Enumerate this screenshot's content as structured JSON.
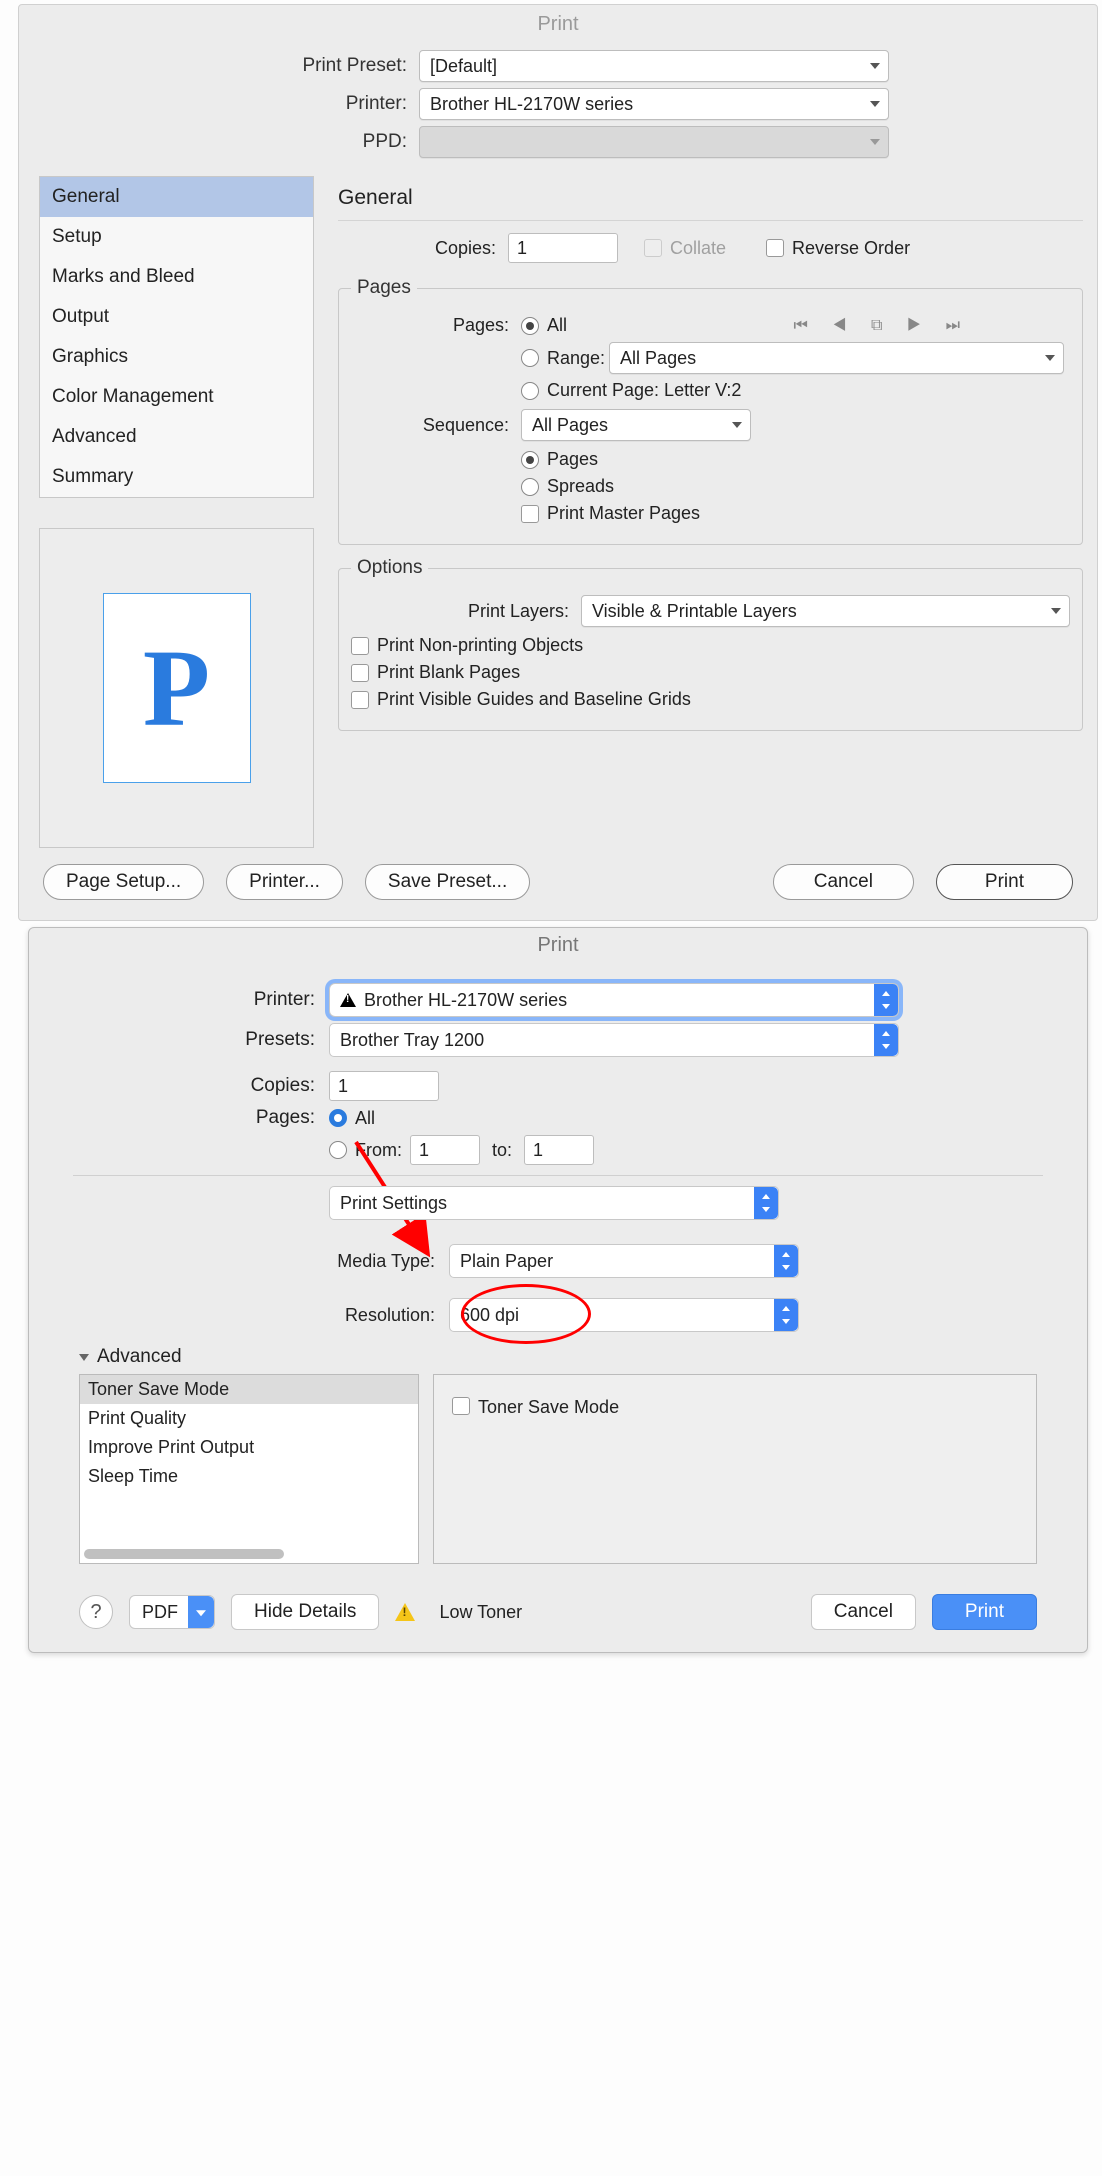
{
  "dialog1": {
    "title": "Print",
    "preset_label": "Print Preset:",
    "preset_value": "[Default]",
    "printer_label": "Printer:",
    "printer_value": "Brother HL-2170W series",
    "ppd_label": "PPD:",
    "sidebar": {
      "items": [
        "General",
        "Setup",
        "Marks and Bleed",
        "Output",
        "Graphics",
        "Color Management",
        "Advanced",
        "Summary"
      ],
      "selected": 0
    },
    "preview_letter": "P",
    "section_title": "General",
    "copies_label": "Copies:",
    "copies_value": "1",
    "collate_label": "Collate",
    "reverse_label": "Reverse Order",
    "pages_group": "Pages",
    "pages_label": "Pages:",
    "pages_all": "All",
    "pages_range": "Range:",
    "range_value": "All Pages",
    "current_page": "Current Page: Letter V:2",
    "sequence_label": "Sequence:",
    "sequence_value": "All Pages",
    "seq_pages": "Pages",
    "seq_spreads": "Spreads",
    "print_master": "Print Master Pages",
    "options_group": "Options",
    "print_layers_label": "Print Layers:",
    "print_layers_value": "Visible & Printable Layers",
    "opt1": "Print Non-printing Objects",
    "opt2": "Print Blank Pages",
    "opt3": "Print Visible Guides and Baseline Grids",
    "btn_page_setup": "Page Setup...",
    "btn_printer": "Printer...",
    "btn_save_preset": "Save Preset...",
    "btn_cancel": "Cancel",
    "btn_print": "Print"
  },
  "dialog2": {
    "title": "Print",
    "printer_label": "Printer:",
    "printer_value": "Brother HL-2170W series",
    "presets_label": "Presets:",
    "presets_value": "Brother Tray 1200",
    "copies_label": "Copies:",
    "copies_value": "1",
    "pages_label": "Pages:",
    "pages_all": "All",
    "pages_from": "From:",
    "pages_from_value": "1",
    "pages_to": "to:",
    "pages_to_value": "1",
    "panel_select": "Print Settings",
    "media_label": "Media Type:",
    "media_value": "Plain Paper",
    "resolution_label": "Resolution:",
    "resolution_value": "600 dpi",
    "advanced_label": "Advanced",
    "adv_items": [
      "Toner Save Mode",
      "Print Quality",
      "Improve Print Output",
      "Sleep Time"
    ],
    "adv_panel_check": "Toner Save Mode",
    "pdf_label": "PDF",
    "hide_details": "Hide Details",
    "low_toner": "Low Toner",
    "cancel": "Cancel",
    "print": "Print",
    "help": "?"
  }
}
